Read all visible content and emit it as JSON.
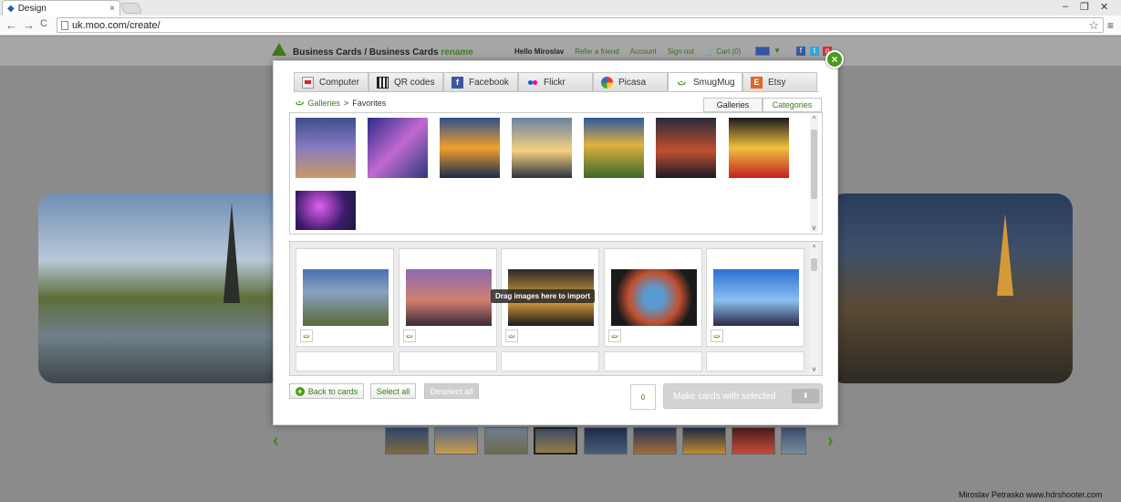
{
  "browser": {
    "tab_title": "Design",
    "tab_close": "×",
    "url": "uk.moo.com/create/",
    "back": "←",
    "forward": "→",
    "reload": "C",
    "star": "☆",
    "menu": "≡",
    "minimize": "–",
    "restore": "❐",
    "close": "✕"
  },
  "header": {
    "breadcrumb": "Business Cards / Business Cards",
    "rename": "rename",
    "hello": "Hello Miroslav",
    "links": [
      "Refer a friend",
      "Account",
      "Sign out"
    ],
    "cart": "Cart (0)",
    "social": [
      "f",
      "t",
      "g"
    ]
  },
  "modal": {
    "close_label": "×",
    "source_tabs": [
      {
        "label": "Computer",
        "icon": "computer-icon"
      },
      {
        "label": "QR codes",
        "icon": "qr-icon"
      },
      {
        "label": "Facebook",
        "icon": "facebook-icon"
      },
      {
        "label": "Flickr",
        "icon": "flickr-icon"
      },
      {
        "label": "Picasa",
        "icon": "picasa-icon"
      },
      {
        "label": "SmugMug",
        "icon": "smugmug-icon"
      },
      {
        "label": "Etsy",
        "icon": "etsy-icon"
      }
    ],
    "active_tab": "SmugMug",
    "gallery_crumb": {
      "root": "Galleries",
      "sep": ">",
      "current": "Favorites"
    },
    "subtabs": [
      "Galleries",
      "Categories"
    ],
    "drag_hint": "Drag images here to import",
    "buttons": {
      "back": "Back to cards",
      "select_all": "Select all",
      "deselect_all": "Deselect all",
      "make": "Make cards with selected"
    },
    "selected_count": "0",
    "smug_glyph": "ت",
    "scroll_up": "^",
    "scroll_down": "v",
    "plus": "+",
    "arrow": "⬇"
  },
  "footer": {
    "credit": "Miroslav  Petrasko  www.hdrshooter.com",
    "prev": "‹",
    "next": "›"
  },
  "colors": {
    "accent": "#4c9a1c",
    "link": "#3b7a1a"
  }
}
